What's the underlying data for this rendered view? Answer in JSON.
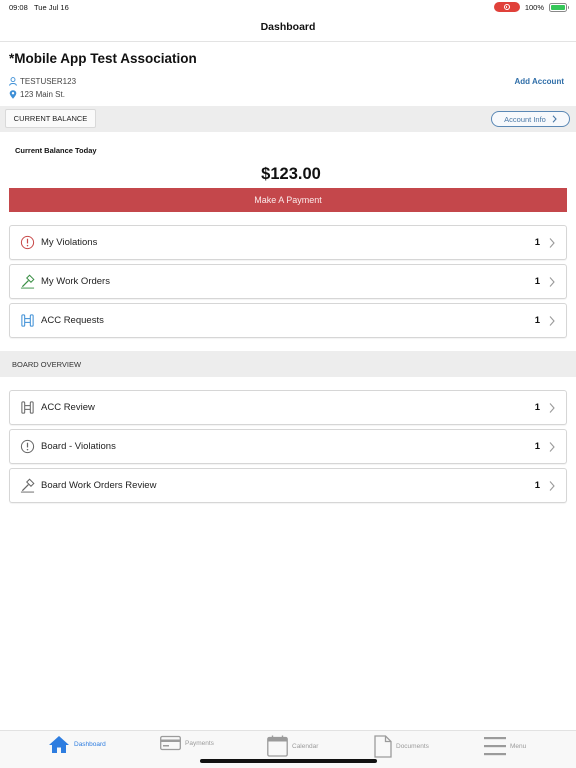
{
  "status_bar": {
    "time": "09:08",
    "date": "Tue Jul 16",
    "battery": "100%",
    "recording_color": "#e0413a"
  },
  "header": {
    "title": "Dashboard"
  },
  "account": {
    "association_name": "*Mobile App Test Association",
    "username": "TESTUSER123",
    "address": "123 Main St.",
    "add_account_label": "Add Account"
  },
  "balance_section": {
    "tab_label": "CURRENT BALANCE",
    "account_info_label": "Account Info",
    "today_label": "Current Balance Today",
    "amount": "$123.00",
    "pay_button_label": "Make A Payment",
    "pay_button_color": "#c4474b"
  },
  "my_items": [
    {
      "label": "My Violations",
      "count": "1",
      "icon": "alert-circle-icon"
    },
    {
      "label": "My Work Orders",
      "count": "1",
      "icon": "hammer-icon"
    },
    {
      "label": "ACC Requests",
      "count": "1",
      "icon": "paint-roller-icon"
    }
  ],
  "board_section": {
    "title": "BOARD OVERVIEW",
    "items": [
      {
        "label": "ACC Review",
        "count": "1",
        "icon": "paint-roller-icon"
      },
      {
        "label": "Board - Violations",
        "count": "1",
        "icon": "alert-circle-icon"
      },
      {
        "label": "Board Work Orders Review",
        "count": "1",
        "icon": "hammer-icon"
      }
    ]
  },
  "tabbar": {
    "tabs": [
      {
        "label": "Dashboard",
        "icon": "home-icon",
        "active": true
      },
      {
        "label": "Payments",
        "icon": "credit-card-icon",
        "active": false
      },
      {
        "label": "Calendar",
        "icon": "calendar-icon",
        "active": false
      },
      {
        "label": "Documents",
        "icon": "document-icon",
        "active": false
      },
      {
        "label": "Menu",
        "icon": "menu-icon",
        "active": false
      }
    ],
    "active_color": "#2e7de0",
    "inactive_color": "#9b9b9b"
  }
}
